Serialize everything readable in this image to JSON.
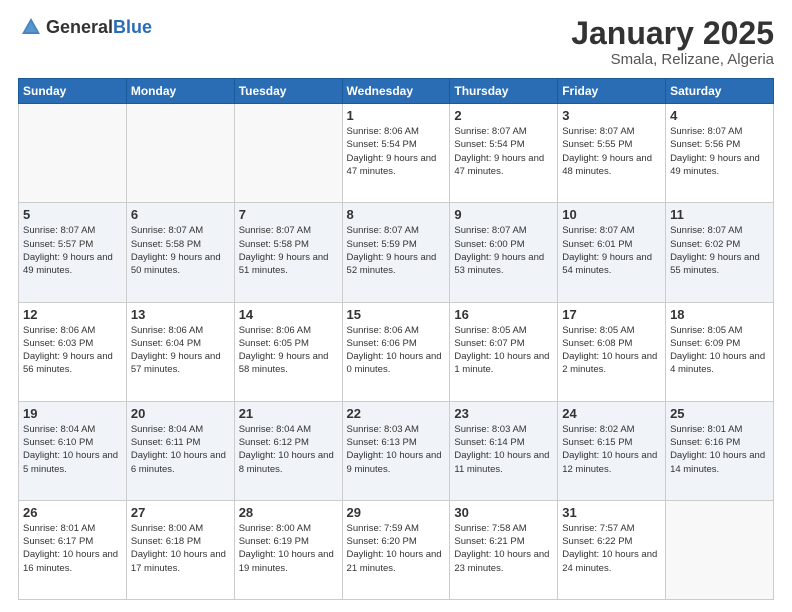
{
  "logo": {
    "general": "General",
    "blue": "Blue"
  },
  "title": "January 2025",
  "subtitle": "Smala, Relizane, Algeria",
  "days_of_week": [
    "Sunday",
    "Monday",
    "Tuesday",
    "Wednesday",
    "Thursday",
    "Friday",
    "Saturday"
  ],
  "weeks": [
    {
      "alt": false,
      "days": [
        {
          "num": "",
          "info": ""
        },
        {
          "num": "",
          "info": ""
        },
        {
          "num": "",
          "info": ""
        },
        {
          "num": "1",
          "info": "Sunrise: 8:06 AM\nSunset: 5:54 PM\nDaylight: 9 hours and 47 minutes."
        },
        {
          "num": "2",
          "info": "Sunrise: 8:07 AM\nSunset: 5:54 PM\nDaylight: 9 hours and 47 minutes."
        },
        {
          "num": "3",
          "info": "Sunrise: 8:07 AM\nSunset: 5:55 PM\nDaylight: 9 hours and 48 minutes."
        },
        {
          "num": "4",
          "info": "Sunrise: 8:07 AM\nSunset: 5:56 PM\nDaylight: 9 hours and 49 minutes."
        }
      ]
    },
    {
      "alt": true,
      "days": [
        {
          "num": "5",
          "info": "Sunrise: 8:07 AM\nSunset: 5:57 PM\nDaylight: 9 hours and 49 minutes."
        },
        {
          "num": "6",
          "info": "Sunrise: 8:07 AM\nSunset: 5:58 PM\nDaylight: 9 hours and 50 minutes."
        },
        {
          "num": "7",
          "info": "Sunrise: 8:07 AM\nSunset: 5:58 PM\nDaylight: 9 hours and 51 minutes."
        },
        {
          "num": "8",
          "info": "Sunrise: 8:07 AM\nSunset: 5:59 PM\nDaylight: 9 hours and 52 minutes."
        },
        {
          "num": "9",
          "info": "Sunrise: 8:07 AM\nSunset: 6:00 PM\nDaylight: 9 hours and 53 minutes."
        },
        {
          "num": "10",
          "info": "Sunrise: 8:07 AM\nSunset: 6:01 PM\nDaylight: 9 hours and 54 minutes."
        },
        {
          "num": "11",
          "info": "Sunrise: 8:07 AM\nSunset: 6:02 PM\nDaylight: 9 hours and 55 minutes."
        }
      ]
    },
    {
      "alt": false,
      "days": [
        {
          "num": "12",
          "info": "Sunrise: 8:06 AM\nSunset: 6:03 PM\nDaylight: 9 hours and 56 minutes."
        },
        {
          "num": "13",
          "info": "Sunrise: 8:06 AM\nSunset: 6:04 PM\nDaylight: 9 hours and 57 minutes."
        },
        {
          "num": "14",
          "info": "Sunrise: 8:06 AM\nSunset: 6:05 PM\nDaylight: 9 hours and 58 minutes."
        },
        {
          "num": "15",
          "info": "Sunrise: 8:06 AM\nSunset: 6:06 PM\nDaylight: 10 hours and 0 minutes."
        },
        {
          "num": "16",
          "info": "Sunrise: 8:05 AM\nSunset: 6:07 PM\nDaylight: 10 hours and 1 minute."
        },
        {
          "num": "17",
          "info": "Sunrise: 8:05 AM\nSunset: 6:08 PM\nDaylight: 10 hours and 2 minutes."
        },
        {
          "num": "18",
          "info": "Sunrise: 8:05 AM\nSunset: 6:09 PM\nDaylight: 10 hours and 4 minutes."
        }
      ]
    },
    {
      "alt": true,
      "days": [
        {
          "num": "19",
          "info": "Sunrise: 8:04 AM\nSunset: 6:10 PM\nDaylight: 10 hours and 5 minutes."
        },
        {
          "num": "20",
          "info": "Sunrise: 8:04 AM\nSunset: 6:11 PM\nDaylight: 10 hours and 6 minutes."
        },
        {
          "num": "21",
          "info": "Sunrise: 8:04 AM\nSunset: 6:12 PM\nDaylight: 10 hours and 8 minutes."
        },
        {
          "num": "22",
          "info": "Sunrise: 8:03 AM\nSunset: 6:13 PM\nDaylight: 10 hours and 9 minutes."
        },
        {
          "num": "23",
          "info": "Sunrise: 8:03 AM\nSunset: 6:14 PM\nDaylight: 10 hours and 11 minutes."
        },
        {
          "num": "24",
          "info": "Sunrise: 8:02 AM\nSunset: 6:15 PM\nDaylight: 10 hours and 12 minutes."
        },
        {
          "num": "25",
          "info": "Sunrise: 8:01 AM\nSunset: 6:16 PM\nDaylight: 10 hours and 14 minutes."
        }
      ]
    },
    {
      "alt": false,
      "days": [
        {
          "num": "26",
          "info": "Sunrise: 8:01 AM\nSunset: 6:17 PM\nDaylight: 10 hours and 16 minutes."
        },
        {
          "num": "27",
          "info": "Sunrise: 8:00 AM\nSunset: 6:18 PM\nDaylight: 10 hours and 17 minutes."
        },
        {
          "num": "28",
          "info": "Sunrise: 8:00 AM\nSunset: 6:19 PM\nDaylight: 10 hours and 19 minutes."
        },
        {
          "num": "29",
          "info": "Sunrise: 7:59 AM\nSunset: 6:20 PM\nDaylight: 10 hours and 21 minutes."
        },
        {
          "num": "30",
          "info": "Sunrise: 7:58 AM\nSunset: 6:21 PM\nDaylight: 10 hours and 23 minutes."
        },
        {
          "num": "31",
          "info": "Sunrise: 7:57 AM\nSunset: 6:22 PM\nDaylight: 10 hours and 24 minutes."
        },
        {
          "num": "",
          "info": ""
        }
      ]
    }
  ]
}
